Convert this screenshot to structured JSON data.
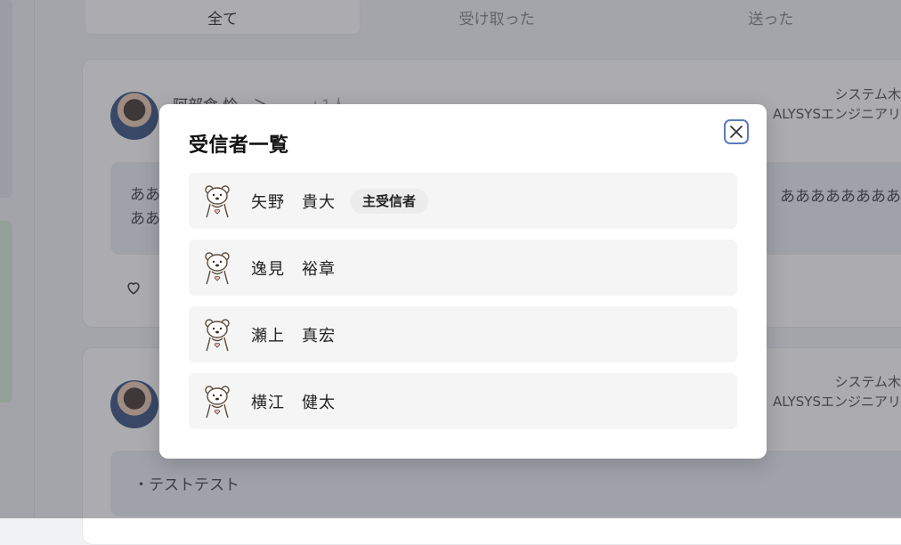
{
  "tabs": [
    {
      "label": "全て",
      "active": true
    },
    {
      "label": "受け取った",
      "active": false
    },
    {
      "label": "送った",
      "active": false
    }
  ],
  "posts": [
    {
      "sender_text": "阿部倉 怜　＞",
      "extra_count": "+1人",
      "dept_line1": "システム木",
      "dept_line2": "ALYSYSエンジニアリ",
      "message_left_line1": "ああ",
      "message_left_line2": "ああ",
      "message_right": "ああああああああ"
    },
    {
      "dept_line1": "システム木",
      "dept_line2": "ALYSYSエンジニアリ",
      "message": "・テストテスト"
    }
  ],
  "modal": {
    "title": "受信者一覧",
    "close_icon": "close-icon",
    "recipients": [
      {
        "name": "矢野　貴大",
        "badge": "主受信者",
        "icon": "bear-icon"
      },
      {
        "name": "逸見　裕章",
        "icon": "bear-icon"
      },
      {
        "name": "瀬上　真宏",
        "icon": "bear-icon"
      },
      {
        "name": "横江　健太",
        "icon": "bear-icon"
      }
    ]
  },
  "colors": {
    "overlay": "#46485073",
    "modal_bg": "#ffffff",
    "row_bg": "#f5f5f6",
    "badge_bg": "#ececec",
    "close_border": "#5a7bb8",
    "bubble_bg": "#e9edf5"
  }
}
